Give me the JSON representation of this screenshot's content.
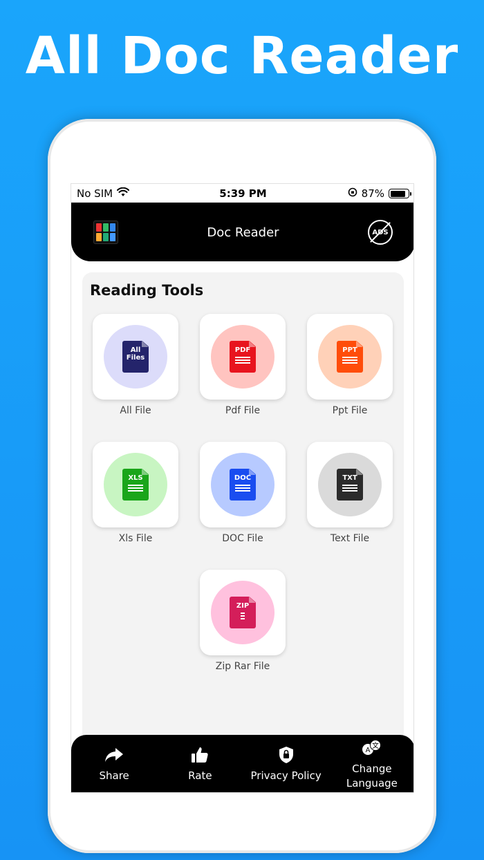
{
  "promo": {
    "title": "All Doc Reader"
  },
  "status_bar": {
    "carrier": "No SIM",
    "time": "5:39 PM",
    "battery": "87%",
    "battery_level": 0.87
  },
  "header": {
    "title": "Doc Reader",
    "noads_icon_text": "ADS"
  },
  "tools": {
    "heading": "Reading Tools",
    "items": [
      {
        "label": "All File",
        "icon_text": "All\nFiles",
        "circle_color": "#dcdcfa",
        "icon_color": "#24246b"
      },
      {
        "label": "Pdf File",
        "icon_text": "PDF",
        "circle_color": "#ffc4c0",
        "icon_color": "#e8141e"
      },
      {
        "label": "Ppt File",
        "icon_text": "PPT",
        "circle_color": "#ffd1b8",
        "icon_color": "#ff4d0a"
      },
      {
        "label": "Xls File",
        "icon_text": "XLS",
        "circle_color": "#c8f5c2",
        "icon_color": "#1aa51a"
      },
      {
        "label": "DOC File",
        "icon_text": "DOC",
        "circle_color": "#b7caff",
        "icon_color": "#1a4df0"
      },
      {
        "label": "Text File",
        "icon_text": "TXT",
        "circle_color": "#dadada",
        "icon_color": "#2b2b2b"
      },
      {
        "label": "Zip Rar File",
        "icon_text": "ZIP",
        "circle_color": "#ffc1de",
        "icon_color": "#d41e5a"
      }
    ]
  },
  "bottom_nav": {
    "items": [
      {
        "label": "Share",
        "icon": "share-icon"
      },
      {
        "label": "Rate",
        "icon": "thumbs-up-icon"
      },
      {
        "label": "Privacy Policy",
        "icon": "shield-lock-icon"
      },
      {
        "label": "Change Language",
        "icon": "translate-icon"
      }
    ]
  }
}
